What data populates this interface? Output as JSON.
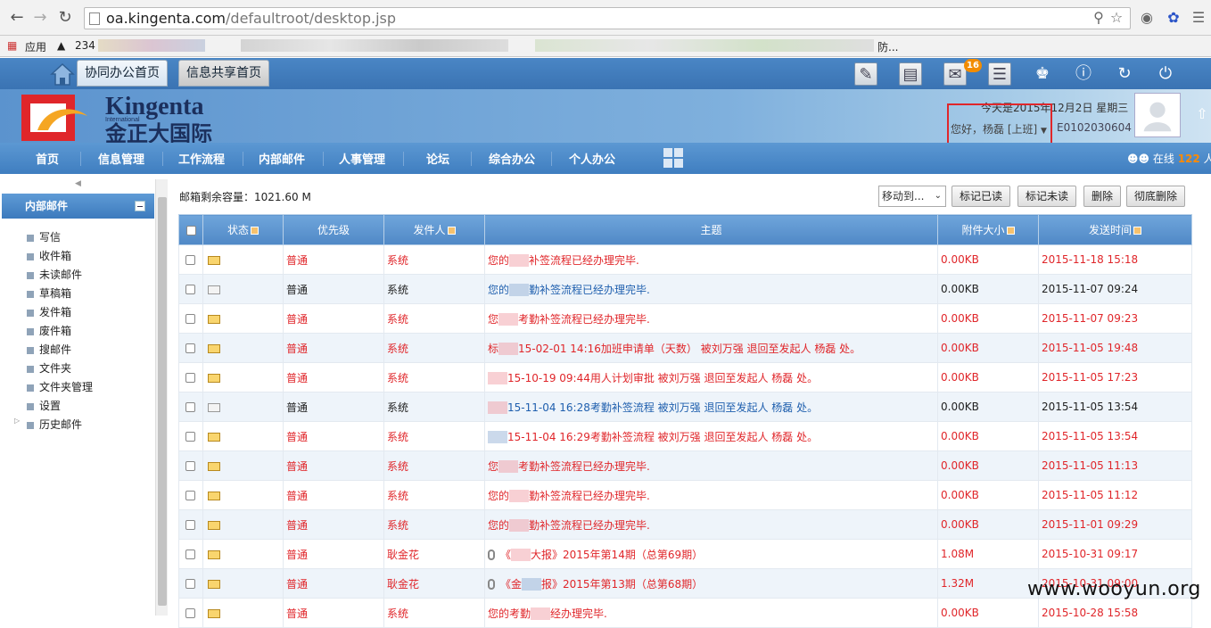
{
  "browser": {
    "url_host": "oa.kingenta.com",
    "url_path": "/defaultroot/desktop.jsp",
    "bookmarks": [
      {
        "label": "应用"
      },
      {
        "label": "234"
      },
      {
        "label": "防..."
      }
    ]
  },
  "header": {
    "tabs": [
      {
        "label": "协同办公首页"
      },
      {
        "label": "信息共享首页"
      }
    ],
    "mail_badge": "16",
    "logo_name_en": "Kingenta",
    "logo_sub": "International",
    "logo_name_cn": "金正大国际",
    "date_text": "今天是2015年12月2日 星期三",
    "greeting": "您好，杨磊 [上班]",
    "user_id": "E0102030604",
    "online_prefix": "在线",
    "online_count": "122",
    "online_suffix": "人"
  },
  "nav": {
    "items": [
      {
        "label": "首页"
      },
      {
        "label": "信息管理"
      },
      {
        "label": "工作流程"
      },
      {
        "label": "内部邮件"
      },
      {
        "label": "人事管理"
      },
      {
        "label": "论坛"
      },
      {
        "label": "综合办公"
      },
      {
        "label": "个人办公"
      }
    ]
  },
  "sidebar": {
    "title": "内部邮件",
    "items": [
      {
        "label": "写信"
      },
      {
        "label": "收件箱"
      },
      {
        "label": "未读邮件"
      },
      {
        "label": "草稿箱"
      },
      {
        "label": "发件箱"
      },
      {
        "label": "废件箱"
      },
      {
        "label": "搜邮件"
      },
      {
        "label": "文件夹"
      },
      {
        "label": "文件夹管理"
      },
      {
        "label": "设置"
      },
      {
        "label": "历史邮件"
      }
    ]
  },
  "mailbox": {
    "capacity": "邮箱剩余容量：1021.60 M",
    "move_to": "移动到...",
    "buttons": {
      "mark_read": "标记已读",
      "mark_unread": "标记未读",
      "delete": "删除",
      "delete_all": "彻底删除"
    },
    "columns": {
      "status": "状态",
      "priority": "优先级",
      "sender": "发件人",
      "subject": "主题",
      "size": "附件大小",
      "time": "发送时间"
    },
    "rows": [
      {
        "read": false,
        "priority": "普通",
        "sender": "系统",
        "subj_pre": "您的",
        "subj": "补签流程已经办理完毕.",
        "attach": false,
        "size": "0.00KB",
        "time": "2015-11-18 15:18"
      },
      {
        "read": true,
        "priority": "普通",
        "sender": "系统",
        "subj_pre": "您的",
        "subj": "勤补签流程已经办理完毕.",
        "attach": false,
        "size": "0.00KB",
        "time": "2015-11-07 09:24"
      },
      {
        "read": false,
        "priority": "普通",
        "sender": "系统",
        "subj_pre": "您",
        "subj": "考勤补签流程已经办理完毕.",
        "attach": false,
        "size": "0.00KB",
        "time": "2015-11-07 09:23"
      },
      {
        "read": false,
        "priority": "普通",
        "sender": "系统",
        "subj_pre": "标",
        "subj": "15-02-01 14:16加班申请单（天数） 被刘万强 退回至发起人 杨磊 处。",
        "attach": false,
        "size": "0.00KB",
        "time": "2015-11-05 19:48"
      },
      {
        "read": false,
        "priority": "普通",
        "sender": "系统",
        "subj_pre": "",
        "subj": "15-10-19 09:44用人计划审批 被刘万强 退回至发起人 杨磊 处。",
        "attach": false,
        "size": "0.00KB",
        "time": "2015-11-05 17:23"
      },
      {
        "read": true,
        "priority": "普通",
        "sender": "系统",
        "subj_pre": "",
        "subj": "15-11-04 16:28考勤补签流程 被刘万强 退回至发起人 杨磊 处。",
        "attach": false,
        "size": "0.00KB",
        "time": "2015-11-05 13:54"
      },
      {
        "read": false,
        "priority": "普通",
        "sender": "系统",
        "subj_pre": "",
        "subj": "15-11-04 16:29考勤补签流程 被刘万强 退回至发起人 杨磊 处。",
        "attach": false,
        "size": "0.00KB",
        "time": "2015-11-05 13:54"
      },
      {
        "read": false,
        "priority": "普通",
        "sender": "系统",
        "subj_pre": "您",
        "subj": "考勤补签流程已经办理完毕.",
        "attach": false,
        "size": "0.00KB",
        "time": "2015-11-05 11:13"
      },
      {
        "read": false,
        "priority": "普通",
        "sender": "系统",
        "subj_pre": "您的",
        "subj": "勤补签流程已经办理完毕.",
        "attach": false,
        "size": "0.00KB",
        "time": "2015-11-05 11:12"
      },
      {
        "read": false,
        "priority": "普通",
        "sender": "系统",
        "subj_pre": "您的",
        "subj": "勤补签流程已经办理完毕.",
        "attach": false,
        "size": "0.00KB",
        "time": "2015-11-01 09:29"
      },
      {
        "read": false,
        "priority": "普通",
        "sender": "耿金花",
        "subj_pre": "《",
        "subj": "大报》2015年第14期（总第69期）",
        "attach": true,
        "size": "1.08M",
        "time": "2015-10-31 09:17"
      },
      {
        "read": false,
        "priority": "普通",
        "sender": "耿金花",
        "subj_pre": "《金",
        "subj": "报》2015年第13期（总第68期）",
        "attach": true,
        "size": "1.32M",
        "time": "2015-10-31 09:00"
      },
      {
        "read": false,
        "priority": "普通",
        "sender": "系统",
        "subj_pre": "您的考勤",
        "subj": "经办理完毕.",
        "attach": false,
        "size": "0.00KB",
        "time": "2015-10-28 15:58"
      }
    ]
  },
  "watermark": "www.wooyun.org",
  "colors": {
    "unread": "#e0262a",
    "read_subject": "#1f5fae",
    "header_blue": "#4f88c6",
    "highlight_box": "#e0262a"
  }
}
